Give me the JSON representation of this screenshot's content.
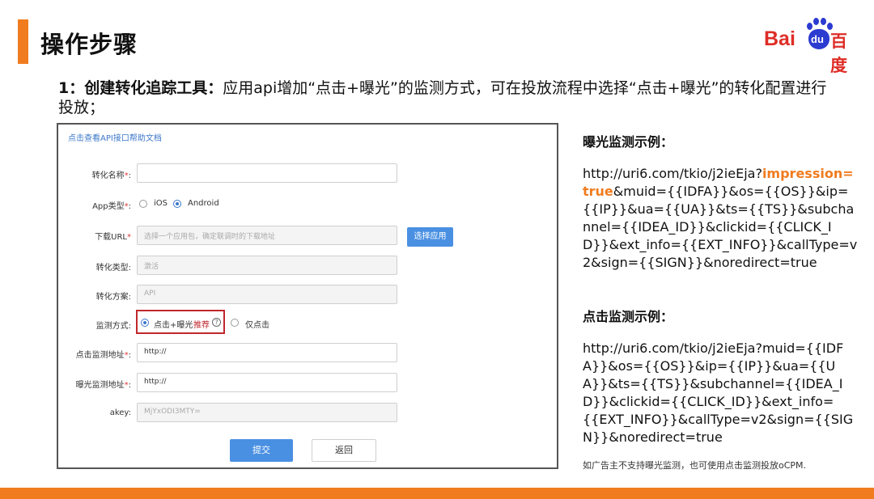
{
  "header": {
    "title": "操作步骤",
    "accent_color": "#f07c1f"
  },
  "logo": {
    "latin": "Bai",
    "paw_text": "du",
    "chinese": "百度",
    "red": "#de2d26",
    "blue": "#2c3bd0"
  },
  "intro": {
    "lead": "1：创建转化追踪工具：",
    "text": "应用api增加“点击+曝光”的监测方式，可在投放流程中选择“点击+曝光”的转化配置进行投放；"
  },
  "form": {
    "help_link": "点击查看API接口帮助文档",
    "required_mark": "*",
    "rows": {
      "conversion_name": {
        "label": "转化名称",
        "value": ""
      },
      "app_type": {
        "label": "App类型",
        "options": [
          "iOS",
          "Android"
        ],
        "selected": "Android"
      },
      "download_url": {
        "label": "下载URL",
        "placeholder": "选择一个应用包，确定联调时的下载地址",
        "button": "选择应用"
      },
      "conversion_type": {
        "label": "转化类型",
        "value": "激活"
      },
      "conversion_plan": {
        "label": "转化方案",
        "value": "API"
      },
      "monitor_method": {
        "label": "监测方式",
        "option_click_impression": "点击+曝光",
        "recommend": "推荐",
        "option_click_only": "仅点击",
        "selected": "点击+曝光"
      },
      "click_monitor_url": {
        "label": "点击监测地址",
        "value": "http://"
      },
      "impression_monitor_url": {
        "label": "曝光监测地址",
        "value": "http://"
      },
      "akey": {
        "label": "akey",
        "value": "MjYxODI3MTY="
      }
    },
    "submit": "提交",
    "back": "返回",
    "primary_color": "#4a90e2",
    "highlight_color": "#c0272d"
  },
  "examples": {
    "impression_heading": "曝光监测示例：",
    "impression_url_prefix": "http://uri6.com/tkio/j2ieEja?",
    "impression_url_highlight": "impression=true",
    "impression_url_suffix": "&muid={{IDFA}}&os={{OS}}&ip={{IP}}&ua={{UA}}&ts={{TS}}&subchannel={{IDEA_ID}}&clickid={{CLICK_ID}}&ext_info={{EXT_INFO}}&callType=v2&sign={{SIGN}}&noredirect=true",
    "click_heading": "点击监测示例：",
    "click_url": "http://uri6.com/tkio/j2ieEja?muid={{IDFA}}&os={{OS}}&ip={{IP}}&ua={{UA}}&ts={{TS}}&subchannel={{IDEA_ID}}&clickid={{CLICK_ID}}&ext_info={{EXT_INFO}}&callType=v2&sign={{SIGN}}&noredirect=true",
    "note": "如广告主不支持曝光监测，也可使用点击监测投放oCPM."
  }
}
